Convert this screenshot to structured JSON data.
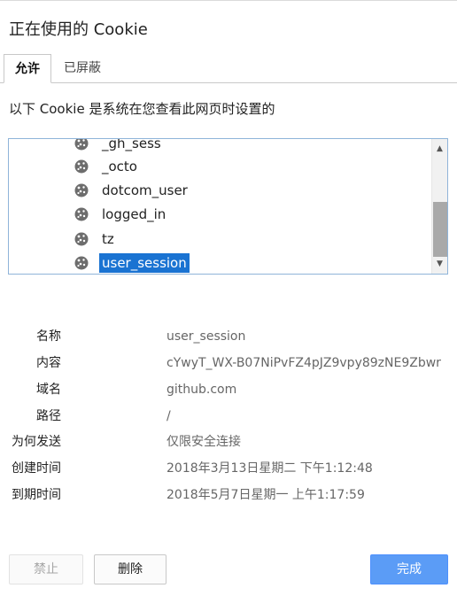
{
  "dialog": {
    "title": "正在使用的 Cookie",
    "subtitle": "以下 Cookie 是系统在您查看此网页时设置的"
  },
  "tabs": [
    {
      "label": "允许",
      "active": true
    },
    {
      "label": "已屏蔽",
      "active": false
    }
  ],
  "cookies": {
    "items": [
      {
        "name": "_gh_sess",
        "icon": "cookie-icon",
        "selected": false
      },
      {
        "name": "_octo",
        "icon": "cookie-icon",
        "selected": false
      },
      {
        "name": "dotcom_user",
        "icon": "cookie-icon",
        "selected": false
      },
      {
        "name": "logged_in",
        "icon": "cookie-icon",
        "selected": false
      },
      {
        "name": "tz",
        "icon": "cookie-icon",
        "selected": false
      },
      {
        "name": "user_session",
        "icon": "cookie-icon",
        "selected": true
      }
    ],
    "scroll": {
      "up_arrow": "▲",
      "down_arrow": "▼"
    }
  },
  "details": [
    {
      "label": "名称",
      "value": "user_session"
    },
    {
      "label": "内容",
      "value": "cYwyT_WX-B07NiPvFZ4pJZ9vpy89zNE9Zbwr"
    },
    {
      "label": "域名",
      "value": "github.com"
    },
    {
      "label": "路径",
      "value": "/"
    },
    {
      "label": "为何发送",
      "value": "仅限安全连接"
    },
    {
      "label": "创建时间",
      "value": "2018年3月13日星期二 下午1:12:48"
    },
    {
      "label": "到期时间",
      "value": "2018年5月7日星期一 上午1:17:59"
    }
  ],
  "buttons": {
    "block": "禁止",
    "delete": "删除",
    "done": "完成"
  },
  "colors": {
    "selection": "#1a73d2",
    "primary_button": "#5b9cf6",
    "listbox_border": "#8fb4d9"
  }
}
